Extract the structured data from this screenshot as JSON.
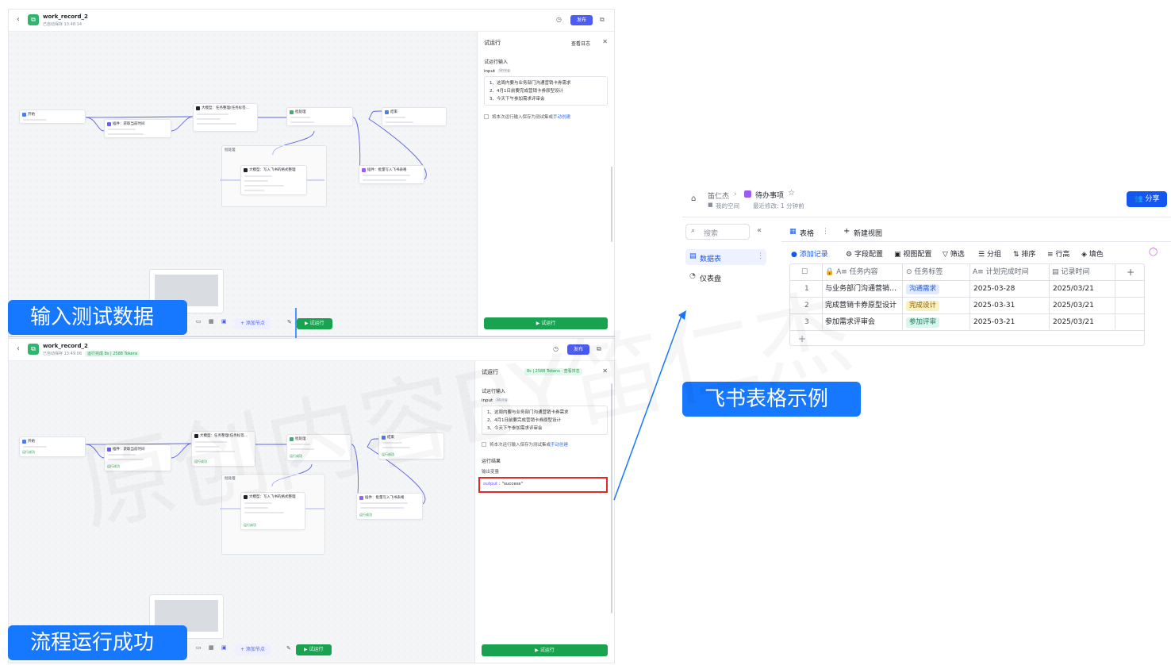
{
  "colors": {
    "accent_blue": "#1677ff",
    "publish_purple": "#4c5cf5",
    "run_green": "#19a350",
    "highlight_red": "#e02b2b"
  },
  "top_panel": {
    "workflow_title": "work_record_2",
    "saved_text": "已自动保存 13:48:14",
    "publish_label": "发布",
    "add_node_label": "+ 添加节点",
    "trial_run_label": "▶ 试运行",
    "side": {
      "title": "试运行",
      "view_log": "查看日志",
      "input_section": "试运行输入",
      "input_label": "input",
      "input_type": "String",
      "input_lines": [
        "1、这周内要与业务部门沟通营销卡券需求",
        "2、4月1日前要完成营销卡券原型设计",
        "3、今天下午参加需求评审会"
      ],
      "save_text": "将本次运行输入保存为测试集或",
      "save_link": "手动创建",
      "run_label": "▶ 试运行"
    }
  },
  "bottom_panel": {
    "workflow_title": "work_record_2",
    "saved_text": "已自动保存 13:49:06",
    "run_badge": "运行完成 8s | 2588 Tokens",
    "publish_label": "发布",
    "add_node_label": "+ 添加节点",
    "trial_run_label": "▶ 试运行",
    "side": {
      "title": "试运行",
      "status_badge": "8s | 2588 Tokens · 查看日志",
      "input_section": "试运行输入",
      "input_label": "input",
      "input_type": "String",
      "input_lines": [
        "1、这周内要与业务部门沟通营销卡券需求",
        "2、4月1日前要完成营销卡券原型设计",
        "3、今天下午参加需求评审会"
      ],
      "save_text": "将本次运行输入保存为测试集或",
      "save_link": "手动创建",
      "result_section": "运行结果",
      "output_var_label": "输出变量",
      "output_key": "output",
      "output_value": " : \"success\"",
      "run_label": "▶ 试运行"
    }
  },
  "nodes": {
    "start": "开始",
    "plugin_time": "插件：获取当前时间",
    "llm_task": "大模型：任务整理(任务标签…",
    "batch": "批处理",
    "llm_format": "大模型：写入飞书的格式整理",
    "plugin_feishu": "插件：批量写入飞书表格",
    "end": "结束",
    "ok": "运行成功"
  },
  "banners": {
    "input_test": "输入测试数据",
    "run_success": "流程运行成功",
    "feishu_example": "飞书表格示例"
  },
  "feishu": {
    "breadcrumb_owner": "笛仁杰",
    "doc_title": "待办事项",
    "space": "我的空间",
    "last_modified": "最近修改: 1 分钟前",
    "share_label": "分享",
    "search_placeholder": "搜索",
    "sidebar": [
      "数据表",
      "仪表盘"
    ],
    "view_tab": "表格",
    "new_view": "新建视图",
    "toolbar": [
      "添加记录",
      "字段配置",
      "视图配置",
      "筛选",
      "分组",
      "排序",
      "行高",
      "填色"
    ],
    "columns": [
      "任务内容",
      "任务标签",
      "计划完成时间",
      "记录时间"
    ],
    "rows": [
      {
        "idx": "1",
        "content": "与业务部门沟通营销…",
        "tag": "沟通需求",
        "plan": "2025-03-28",
        "record": "2025/03/21"
      },
      {
        "idx": "2",
        "content": "完成营销卡券原型设计",
        "tag": "完成设计",
        "plan": "2025-03-31",
        "record": "2025/03/21"
      },
      {
        "idx": "3",
        "content": "参加需求评审会",
        "tag": "参加评审",
        "plan": "2025-03-21",
        "record": "2025/03/21"
      }
    ]
  }
}
